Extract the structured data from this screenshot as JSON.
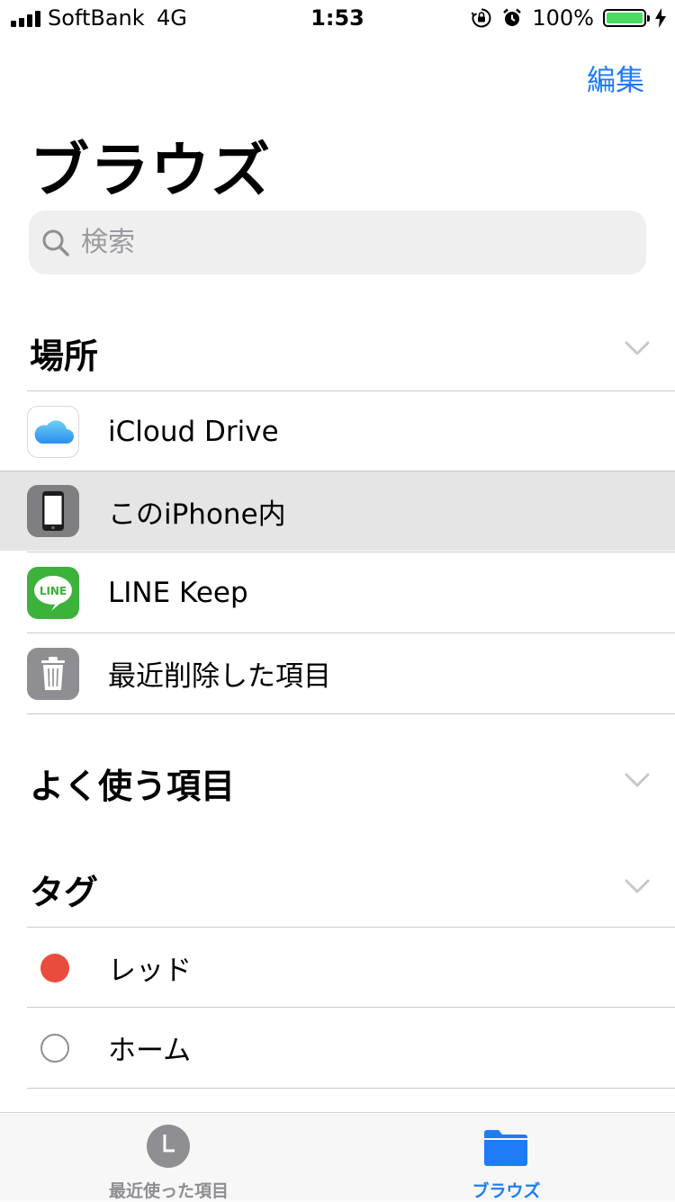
{
  "status_bar": {
    "carrier": "SoftBank",
    "network": "4G",
    "time": "1:53",
    "battery": "100%",
    "battery_color": "#4cd964"
  },
  "header": {
    "edit_label": "編集",
    "title": "ブラウズ"
  },
  "search": {
    "placeholder": "検索",
    "icon": "search-icon"
  },
  "sections": {
    "locations": {
      "title": "場所",
      "items": [
        {
          "label": "iCloud Drive",
          "icon": "icloud-icon"
        },
        {
          "label": "このiPhone内",
          "icon": "iphone-icon",
          "selected": true
        },
        {
          "label": "LINE Keep",
          "icon": "line-icon",
          "icon_text": "LINE"
        },
        {
          "label": "最近削除した項目",
          "icon": "trash-icon"
        }
      ]
    },
    "favorites": {
      "title": "よく使う項目"
    },
    "tags": {
      "title": "タグ",
      "items": [
        {
          "label": "レッド",
          "color": "#e94b3c"
        },
        {
          "label": "ホーム",
          "color": "none"
        }
      ]
    }
  },
  "tab_bar": {
    "tabs": [
      {
        "label": "最近使った項目",
        "icon": "clock-icon",
        "active": false
      },
      {
        "label": "ブラウズ",
        "icon": "folder-icon",
        "active": true
      }
    ]
  },
  "colors": {
    "accent": "#1f7bf6",
    "inactive_tab": "#8e8e93",
    "selected_row": "#e5e5e6"
  }
}
